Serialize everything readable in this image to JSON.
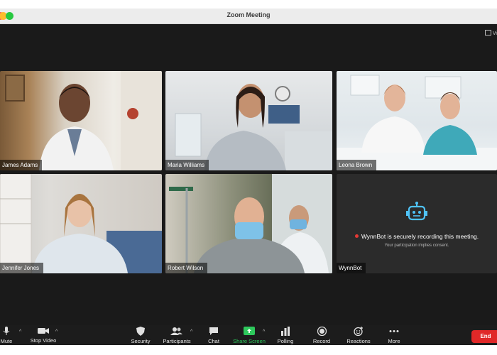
{
  "window": {
    "title": "Zoom Meeting",
    "view_label": "Vi"
  },
  "participants": [
    {
      "name": "James Adams"
    },
    {
      "name": "Maria Williams"
    },
    {
      "name": "Leona Brown"
    },
    {
      "name": "Jennifer Jones"
    },
    {
      "name": "Robert Wilson"
    },
    {
      "name": "WynnBot"
    }
  ],
  "bot_tile": {
    "icon": "robot-icon",
    "recording_text": "WynnBot is securely recording this meeting.",
    "consent_text": "Your participation implies consent.",
    "accent": "#4fc3f7",
    "record_dot_color": "#e53935"
  },
  "toolbar": {
    "mute": "Mute",
    "stop_video": "Stop Video",
    "security": "Security",
    "participants": "Participants",
    "chat": "Chat",
    "share_screen": "Share Screen",
    "polling": "Polling",
    "record": "Record",
    "reactions": "Reactions",
    "more": "More",
    "end": "End",
    "share_color": "#2ec85c",
    "end_color": "#e02828"
  }
}
